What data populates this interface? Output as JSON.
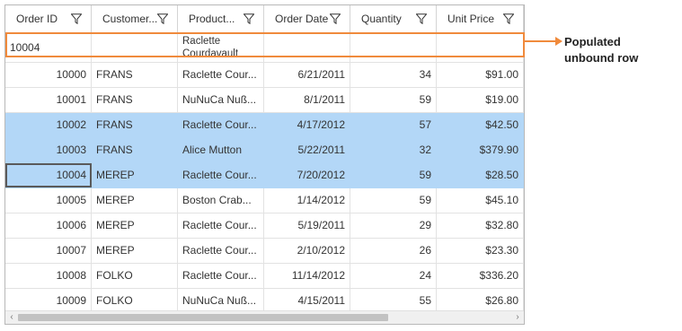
{
  "columns": [
    {
      "label": "Order ID",
      "width": 96
    },
    {
      "label": "Customer...",
      "width": 96
    },
    {
      "label": "Product...",
      "width": 96
    },
    {
      "label": "Order Date",
      "width": 96
    },
    {
      "label": "Quantity",
      "width": 96
    },
    {
      "label": "Unit Price",
      "width": 97
    }
  ],
  "unbound_row": {
    "order_id": "10004",
    "product": "Raclette Courdavault"
  },
  "rows": [
    {
      "order_id": "10000",
      "customer": "FRANS",
      "product": "Raclette  Cour...",
      "date": "6/21/2011",
      "qty": "34",
      "price": "$91.00",
      "selected": false
    },
    {
      "order_id": "10001",
      "customer": "FRANS",
      "product": "NuNuCa  Nuß...",
      "date": "8/1/2011",
      "qty": "59",
      "price": "$19.00",
      "selected": false
    },
    {
      "order_id": "10002",
      "customer": "FRANS",
      "product": "Raclette  Cour...",
      "date": "4/17/2012",
      "qty": "57",
      "price": "$42.50",
      "selected": true
    },
    {
      "order_id": "10003",
      "customer": "FRANS",
      "product": "Alice Mutton",
      "date": "5/22/2011",
      "qty": "32",
      "price": "$379.90",
      "selected": true
    },
    {
      "order_id": "10004",
      "customer": "MEREP",
      "product": "Raclette  Cour...",
      "date": "7/20/2012",
      "qty": "59",
      "price": "$28.50",
      "selected": true,
      "current": true
    },
    {
      "order_id": "10005",
      "customer": "MEREP",
      "product": "Boston  Crab...",
      "date": "1/14/2012",
      "qty": "59",
      "price": "$45.10",
      "selected": false
    },
    {
      "order_id": "10006",
      "customer": "MEREP",
      "product": "Raclette  Cour...",
      "date": "5/19/2011",
      "qty": "29",
      "price": "$32.80",
      "selected": false
    },
    {
      "order_id": "10007",
      "customer": "MEREP",
      "product": "Raclette  Cour...",
      "date": "2/10/2012",
      "qty": "26",
      "price": "$23.30",
      "selected": false
    },
    {
      "order_id": "10008",
      "customer": "FOLKO",
      "product": "Raclette  Cour...",
      "date": "11/14/2012",
      "qty": "24",
      "price": "$336.20",
      "selected": false
    },
    {
      "order_id": "10009",
      "customer": "FOLKO",
      "product": "NuNuCa  Nuß...",
      "date": "4/15/2011",
      "qty": "55",
      "price": "$26.80",
      "selected": false
    }
  ],
  "callout": {
    "line1": "Populated",
    "line2": "unbound row"
  },
  "colors": {
    "selection": "#b3d7f7",
    "highlight": "#f08a3c"
  },
  "icons": {
    "filter": "filter-icon",
    "scroll_left": "chevron-left-icon",
    "scroll_right": "chevron-right-icon"
  }
}
